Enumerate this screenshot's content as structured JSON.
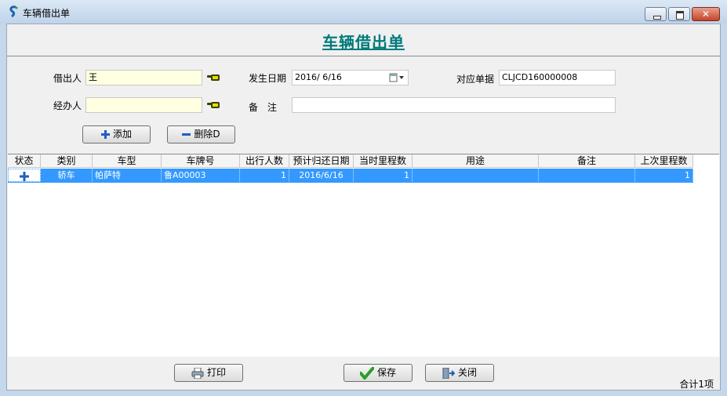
{
  "window": {
    "title": "车辆借出单",
    "buttons": {
      "minimize": "minimize-icon",
      "maximize": "maximize-icon",
      "close": "close-icon"
    }
  },
  "header": {
    "title": "车辆借出单"
  },
  "form": {
    "borrower_label": "借出人",
    "borrower_value": "王",
    "handler_label": "经办人",
    "handler_value": "",
    "date_label": "发生日期",
    "date_value": "2016/ 6/16",
    "remark_label": "备　注",
    "remark_value": "",
    "doc_label": "对应单据",
    "doc_value": "CLJCD160000008"
  },
  "actions": {
    "add_label": "添加",
    "delete_label": "删除D"
  },
  "table": {
    "columns": [
      "状态",
      "类别",
      "车型",
      "车牌号",
      "出行人数",
      "预计归还日期",
      "当时里程数",
      "用途",
      "备注",
      "上次里程数"
    ],
    "rows": [
      {
        "status": "+",
        "category": "轿车",
        "model": "帕萨特",
        "plate": "鲁A00003",
        "passengers": "1",
        "return_date": "2016/6/16",
        "mileage": "1",
        "purpose": "",
        "remark": "",
        "last_mileage": "1"
      }
    ]
  },
  "footer": {
    "print_label": "打印",
    "save_label": "保存",
    "close_label": "关闭",
    "total_text": "合计1项"
  },
  "colors": {
    "title": "#007b7b",
    "selection": "#3399ff",
    "input_highlight": "#ffffe1"
  }
}
